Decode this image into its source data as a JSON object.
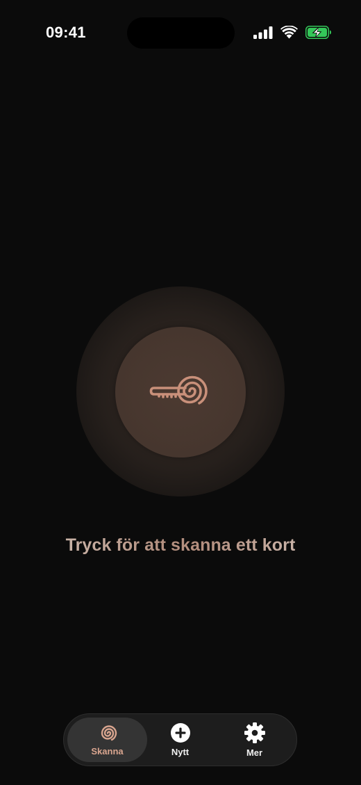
{
  "status_bar": {
    "time": "09:41",
    "icons": [
      "cellular-signal-icon",
      "wifi-icon",
      "battery-charging-icon"
    ],
    "battery_color": "#34c759"
  },
  "scan": {
    "button_icon": "key-spiral-icon",
    "prompt": "Tryck för att skanna ett kort"
  },
  "tab_bar": {
    "items": [
      {
        "label": "Skanna",
        "icon": "spiral-icon",
        "selected": true
      },
      {
        "label": "Nytt",
        "icon": "plus-circle-icon",
        "selected": false
      },
      {
        "label": "Mer",
        "icon": "gear-icon",
        "selected": false
      }
    ]
  },
  "colors": {
    "background": "#0b0b0b",
    "accent": "#c9907a",
    "accent_dim": "#b48e7e"
  }
}
